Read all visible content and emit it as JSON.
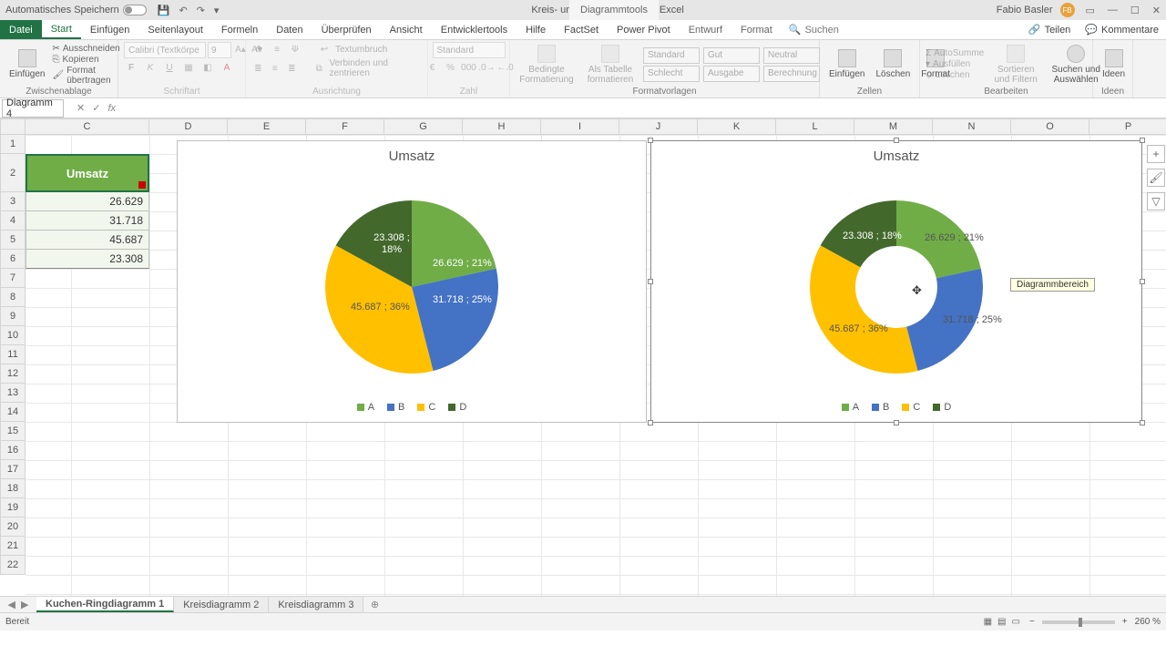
{
  "titlebar": {
    "autosave": "Automatisches Speichern",
    "doc_title": "Kreis- und Ringdiagramme - Excel",
    "tool_tab": "Diagrammtools",
    "user": "Fabio Basler",
    "user_initials": "FB"
  },
  "tabs": {
    "file": "Datei",
    "home": "Start",
    "insert": "Einfügen",
    "pagelayout": "Seitenlayout",
    "formulas": "Formeln",
    "data": "Daten",
    "review": "Überprüfen",
    "view": "Ansicht",
    "developer": "Entwicklertools",
    "help": "Hilfe",
    "factset": "FactSet",
    "powerpivot": "Power Pivot",
    "design": "Entwurf",
    "format": "Format",
    "search": "Suchen",
    "share": "Teilen",
    "comments": "Kommentare"
  },
  "ribbon": {
    "paste": "Einfügen",
    "cut": "Ausschneiden",
    "copy": "Kopieren",
    "format_painter": "Format übertragen",
    "clipboard": "Zwischenablage",
    "font_name": "Calibri (Textkörpe",
    "font_size": "9",
    "font_group": "Schriftart",
    "wrap": "Textumbruch",
    "merge": "Verbinden und zentrieren",
    "alignment": "Ausrichtung",
    "number_format": "Standard",
    "number": "Zahl",
    "cond_format": "Bedingte Formatierung",
    "as_table": "Als Tabelle formatieren",
    "style_standard": "Standard",
    "style_gut": "Gut",
    "style_schlecht": "Schlecht",
    "style_ausgabe": "Ausgabe",
    "style_neutral": "Neutral",
    "style_berechnung": "Berechnung",
    "styles": "Formatvorlagen",
    "insert_cells": "Einfügen",
    "delete_cells": "Löschen",
    "format_cells": "Format",
    "cells": "Zellen",
    "autosum": "AutoSumme",
    "fill": "Ausfüllen",
    "clear": "Löschen",
    "sort": "Sortieren und Filtern",
    "find": "Suchen und Auswählen",
    "editing": "Bearbeiten",
    "ideas": "Ideen"
  },
  "namebox": "Diagramm 4",
  "columns": [
    "C",
    "D",
    "E",
    "F",
    "G",
    "H",
    "I",
    "J",
    "K",
    "L",
    "M",
    "N",
    "O",
    "P"
  ],
  "rows": [
    "1",
    "2",
    "3",
    "4",
    "5",
    "6",
    "7",
    "8",
    "9",
    "10",
    "11",
    "12",
    "13",
    "14",
    "15",
    "16",
    "17",
    "18",
    "19",
    "20",
    "21",
    "22"
  ],
  "table": {
    "header": "Umsatz",
    "values": [
      "26.629",
      "31.718",
      "45.687",
      "23.308"
    ]
  },
  "chart_data": [
    {
      "type": "pie",
      "title": "Umsatz",
      "series": [
        {
          "name": "A",
          "value": 26629,
          "pct": 21,
          "label": "26.629 ; 21%",
          "color": "#70ad47"
        },
        {
          "name": "B",
          "value": 31718,
          "pct": 25,
          "label": "31.718 ; 25%",
          "color": "#4472c4"
        },
        {
          "name": "C",
          "value": 45687,
          "pct": 36,
          "label": "45.687 ; 36%",
          "color": "#ffc000"
        },
        {
          "name": "D",
          "value": 23308,
          "pct": 18,
          "label": "23.308 ; 18%",
          "color": "#43682b"
        }
      ]
    },
    {
      "type": "doughnut",
      "title": "Umsatz",
      "series": [
        {
          "name": "A",
          "value": 26629,
          "pct": 21,
          "label": "26.629 ; 21%",
          "color": "#70ad47"
        },
        {
          "name": "B",
          "value": 31718,
          "pct": 25,
          "label": "31.718 ; 25%",
          "color": "#4472c4"
        },
        {
          "name": "C",
          "value": 45687,
          "pct": 36,
          "label": "45.687 ; 36%",
          "color": "#ffc000"
        },
        {
          "name": "D",
          "value": 23308,
          "pct": 18,
          "label": "23.308 ; 18%",
          "color": "#43682b"
        }
      ]
    }
  ],
  "legend_items": [
    "A",
    "B",
    "C",
    "D"
  ],
  "tooltip": "Diagrammbereich",
  "sheets": {
    "s1": "Kuchen-Ringdiagramm 1",
    "s2": "Kreisdiagramm 2",
    "s3": "Kreisdiagramm 3"
  },
  "status": {
    "ready": "Bereit",
    "zoom": "260 %"
  }
}
